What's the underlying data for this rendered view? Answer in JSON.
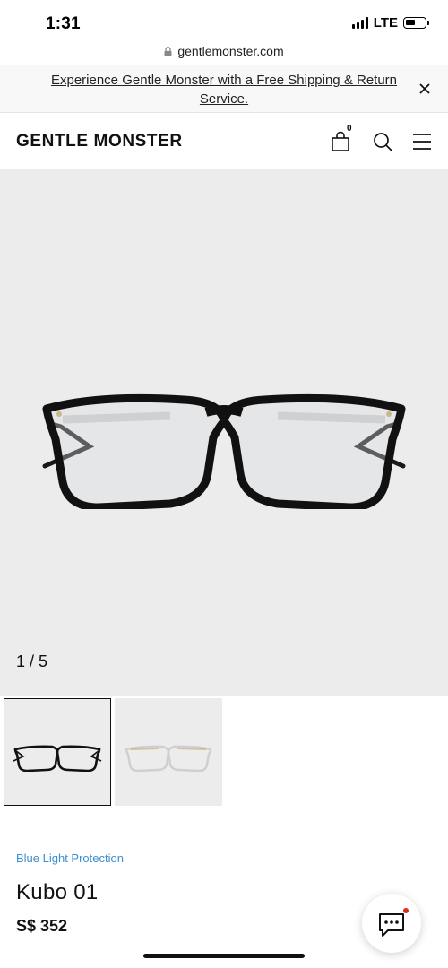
{
  "status_bar": {
    "time": "1:31",
    "network": "LTE",
    "battery_level": 0.55
  },
  "browser": {
    "url": "gentlemonster.com"
  },
  "promo": {
    "text": "Experience Gentle Monster with a Free Shipping & Return Service."
  },
  "header": {
    "logo": "GENTLE MONSTER",
    "cart_count": "0"
  },
  "gallery": {
    "counter": "1 / 5",
    "thumbnails": [
      "black-frame",
      "clear-frame"
    ]
  },
  "product": {
    "tag": "Blue Light Protection",
    "name": "Kubo 01",
    "price": "S$ 352"
  },
  "icons": [
    "lock-icon",
    "close-icon",
    "bag-icon",
    "search-icon",
    "menu-icon",
    "chat-icon"
  ],
  "colors": {
    "accent_link": "#3a8fd0",
    "hero_bg": "#ececec",
    "notification_dot": "#e0271a",
    "frame_black": "#111111"
  }
}
